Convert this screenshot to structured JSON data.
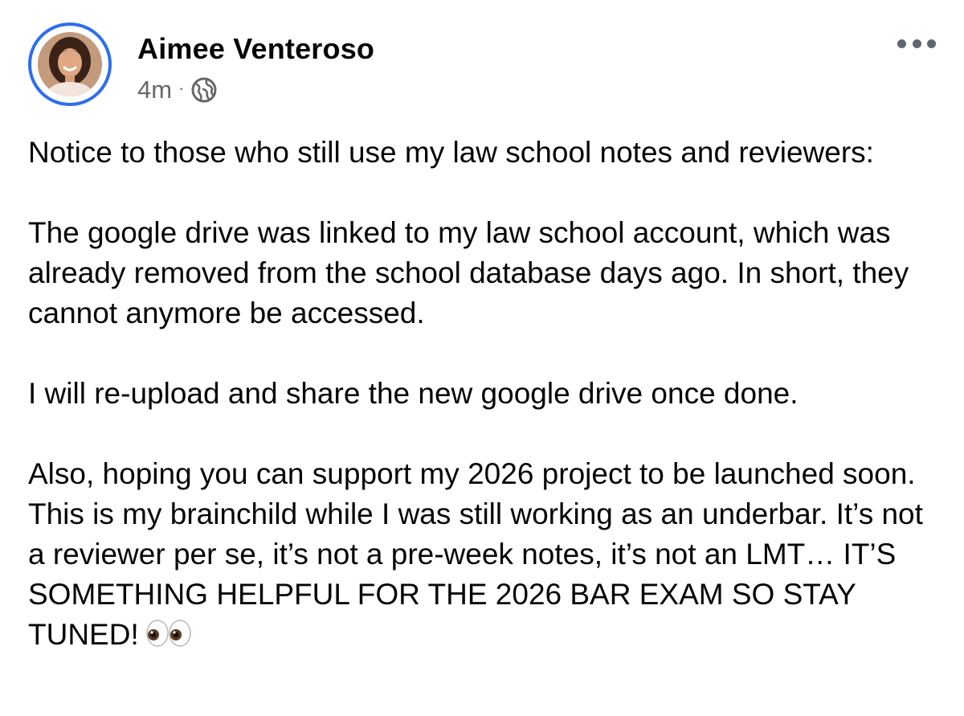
{
  "post": {
    "author": {
      "name": "Aimee Venteroso",
      "avatar_icon": "profile-photo",
      "avatar_ring_color": "#2d6ef0"
    },
    "timestamp": "4m",
    "separator": "·",
    "privacy_icon": "globe-icon",
    "more_icon": "more-options-icon",
    "paragraphs": [
      "Notice to those who still use my law school notes and reviewers:",
      "The google drive was linked to my law school account, which was already removed from the school database days ago. In short, they cannot anymore be accessed.",
      "I will re-upload and share the new google drive once done.",
      "Also, hoping you can support my 2026 project to be launched soon. This is my brainchild while I was still working as an underbar. It’s not a reviewer per se, it’s not a pre-week notes, it’s not an LMT… IT’S SOMETHING HELPFUL FOR THE 2026 BAR EXAM SO STAY TUNED!"
    ],
    "trailing_emoji": "eyes-emoji"
  },
  "colors": {
    "text": "#050505",
    "secondary_text": "#65676b",
    "accent": "#2d6ef0"
  }
}
